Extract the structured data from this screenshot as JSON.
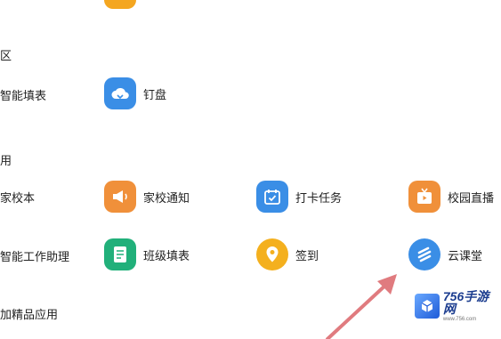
{
  "sections": {
    "first_partial_label": "区",
    "second_partial_label": "用",
    "third_partial_label": "加精品应用"
  },
  "apps": {
    "smart_form": "智能填表",
    "cloud_disk": "钉盘",
    "home_school_book": "家校本",
    "home_school_notice": "家校通知",
    "checkin_task": "打卡任务",
    "campus_live": "校园直播",
    "smart_work_assistant": "智能工作助理",
    "class_form": "班级填表",
    "sign_in": "签到",
    "cloud_classroom": "云课堂"
  },
  "icons": {
    "cloud_disk": "cloud-icon",
    "home_school_notice": "megaphone-icon",
    "checkin_task": "calendar-check-icon",
    "campus_live": "live-tv-icon",
    "class_form": "form-icon",
    "sign_in": "location-pin-icon",
    "cloud_classroom": "stripes-icon"
  },
  "colors": {
    "blue": "#3a8ee6",
    "orange": "#f0903a",
    "green": "#21b07a",
    "yellow": "#f4b01e",
    "arrow": "#e07b7f"
  },
  "watermark": {
    "brand": "756手游网",
    "url": "www.756.com"
  }
}
